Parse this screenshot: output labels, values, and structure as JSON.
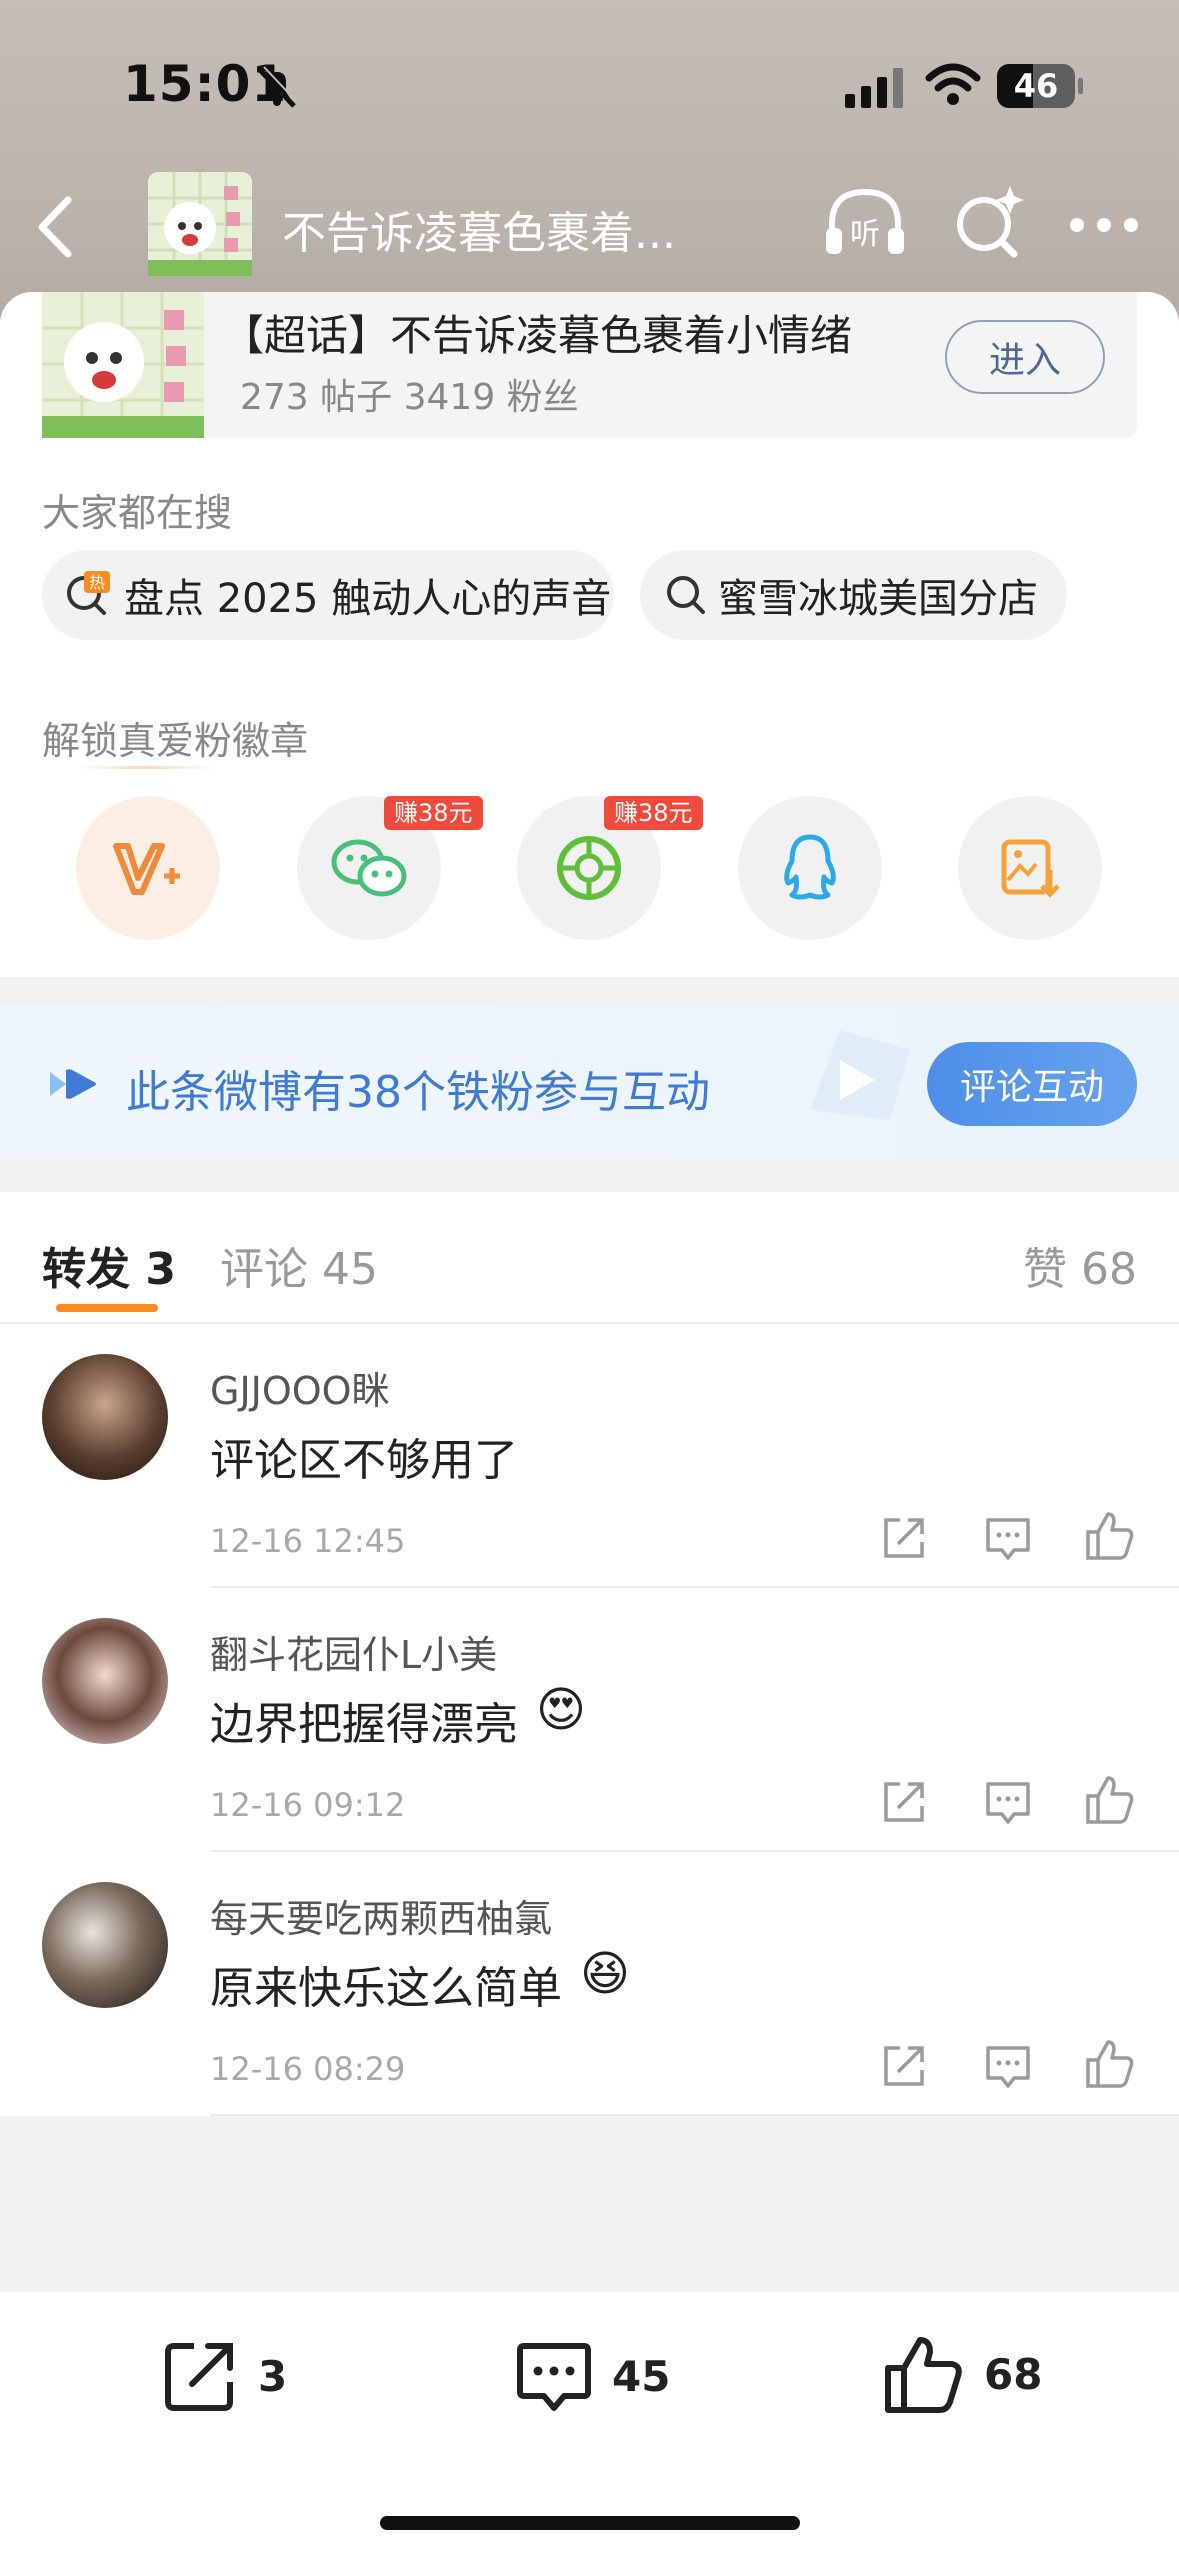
{
  "status_bar": {
    "time": "15:01",
    "battery": "46"
  },
  "nav": {
    "title": "不告诉凌暮色裹着..."
  },
  "topic": {
    "title": "【超话】不告诉凌暮色裹着小情绪",
    "subtitle": "273 帖子 3419 粉丝",
    "enter_label": "进入"
  },
  "search": {
    "label": "大家都在搜",
    "chips": [
      {
        "text": "盘点 2025 触动人心的声音",
        "icon": "hot-search-icon"
      },
      {
        "text": "蜜雪冰城美国分店",
        "icon": "search-icon"
      }
    ]
  },
  "share": {
    "label": "解锁真爱粉徽章",
    "items": [
      {
        "name": "v-plus",
        "icon": "vplus-icon",
        "badge": ""
      },
      {
        "name": "wechat",
        "icon": "wechat-icon",
        "badge": "赚38元"
      },
      {
        "name": "moments",
        "icon": "moments-icon",
        "badge": "赚38元"
      },
      {
        "name": "qq",
        "icon": "qq-icon",
        "badge": ""
      },
      {
        "name": "save-image",
        "icon": "save-image-icon",
        "badge": ""
      }
    ]
  },
  "banner": {
    "text": "此条微博有38个铁粉参与互动",
    "button": "评论互动"
  },
  "tabs": {
    "repost": "转发 3",
    "comment": "评论 45",
    "like": "赞 68"
  },
  "comments": [
    {
      "user": "GJJOOO眯",
      "text": "评论区不够用了",
      "emoji": "",
      "time": "12-16 12:45"
    },
    {
      "user": "翻斗花园仆L小美",
      "text": "边界把握得漂亮",
      "emoji": "😍",
      "time": "12-16 09:12"
    },
    {
      "user": "每天要吃两颗西柚氯",
      "text": "原来快乐这么简单",
      "emoji": "😆",
      "time": "12-16 08:29"
    }
  ],
  "bottom": {
    "repost_count": "3",
    "comment_count": "45",
    "like_count": "68"
  },
  "colors": {
    "accent": "#ff8a1f",
    "blue": "#3f7bd4",
    "wechat": "#4bbf7a",
    "qq": "#2da8e8",
    "vplus": "#f08a3b"
  }
}
